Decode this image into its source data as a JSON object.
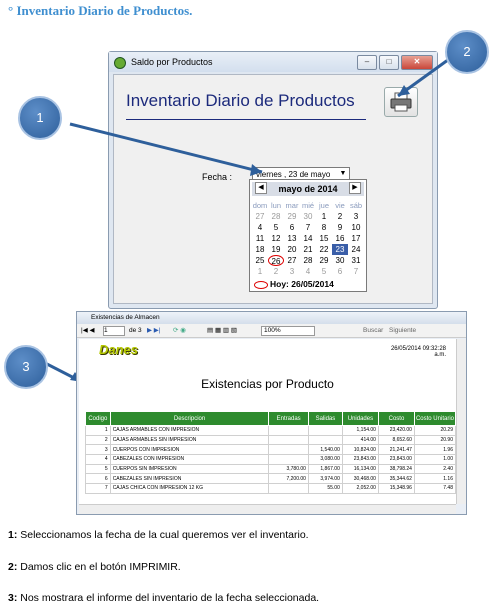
{
  "heading": "° Inventario Diario de Productos.",
  "window1": {
    "title": "Saldo por Productos",
    "form_title": "Inventario Diario de Productos",
    "fecha_label": "Fecha :",
    "date_value": "viernes , 23 de    mayo",
    "calendar": {
      "month_label": "mayo de 2014",
      "weekdays": [
        "dom",
        "lun",
        "mar",
        "mié",
        "jue",
        "vie",
        "sáb"
      ],
      "weeks": [
        [
          "27",
          "28",
          "29",
          "30",
          "1",
          "2",
          "3"
        ],
        [
          "4",
          "5",
          "6",
          "7",
          "8",
          "9",
          "10"
        ],
        [
          "11",
          "12",
          "13",
          "14",
          "15",
          "16",
          "17"
        ],
        [
          "18",
          "19",
          "20",
          "21",
          "22",
          "23",
          "24"
        ],
        [
          "25",
          "26",
          "27",
          "28",
          "29",
          "30",
          "31"
        ],
        [
          "1",
          "2",
          "3",
          "4",
          "5",
          "6",
          "7"
        ]
      ],
      "today_text": "Hoy: 26/05/2014"
    }
  },
  "callouts": [
    "1",
    "2",
    "3"
  ],
  "window2": {
    "title": "Existencias de Almacen",
    "toolbar_page": "1",
    "toolbar_of": "de 3",
    "zoom": "100%",
    "search_label": "Buscar",
    "next_label": "Siguiente",
    "logo": "Danes",
    "report_date": "26/05/2014 09:32:28",
    "report_ampm": "a.m.",
    "report_title": "Existencias por Producto",
    "columns": [
      "Codigo",
      "Descripcion",
      "Entradas",
      "Salidas",
      "Unidades",
      "Costo",
      "Costo Unitario"
    ],
    "rows": [
      [
        "1",
        "CAJAS ARMABLES CON IMPRESION",
        "",
        "",
        "1,154.00",
        "23,420.00",
        "20.29"
      ],
      [
        "2",
        "CAJAS ARMABLES SIN IMPRESION",
        "",
        "",
        "414.00",
        "8,652.60",
        "20.90"
      ],
      [
        "3",
        "CUERPOS CON IMPRESION",
        "",
        "1,540.00",
        "10,824.00",
        "21,241.47",
        "1.96"
      ],
      [
        "4",
        "CABEZALES CON IMPRESION",
        "",
        "3,080.00",
        "23,843.00",
        "23,843.00",
        "1.00"
      ],
      [
        "5",
        "CUERPOS SIN IMPRESION",
        "3,780.00",
        "1,867.00",
        "16,134.00",
        "38,798.24",
        "2.40"
      ],
      [
        "6",
        "CABEZALES SIN IMPRESION",
        "7,200.00",
        "3,974.00",
        "30,468.00",
        "35,344.62",
        "1.16"
      ],
      [
        "7",
        "CAJAS CHICA CON IMPRESION 12 KG",
        "",
        "55.00",
        "2,052.00",
        "15,348.96",
        "7.48"
      ]
    ]
  },
  "instructions": [
    {
      "num": "1:",
      "text": " Seleccionamos la fecha de la cual queremos ver el inventario."
    },
    {
      "num": "2:",
      "text": " Damos clic en el botón IMPRIMIR."
    },
    {
      "num": "3:",
      "text": " Nos mostrara el informe del inventario de la fecha seleccionada."
    }
  ],
  "colors": {
    "accent": "#3f8fd0",
    "callout": "#2e5f9b",
    "table_header": "#2e8b2e",
    "form_title": "#1c2a7c"
  }
}
